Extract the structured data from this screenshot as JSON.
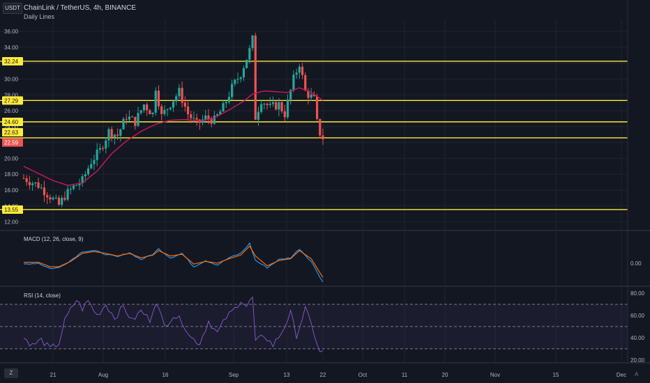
{
  "header": {
    "symbol_line": "ChainLink / TetherUS, 4h, BINANCE",
    "indicator_label": "Daily Lines"
  },
  "toolbar": {
    "unit_button": "USDT",
    "goto_button": "Z",
    "auto_button": "A"
  },
  "colors": {
    "background": "#131722",
    "grid": "#1f2430",
    "up_candle": "#26a69a",
    "down_candle": "#ef5350",
    "level_line": "#ffeb3b",
    "ma_line": "#c2185b",
    "macd_line": "#2196f3",
    "signal_line": "#ff6d00",
    "rsi_line": "#7e57c2",
    "rsi_band": "#7e57c2"
  },
  "chart_data": [
    {
      "type": "candlestick",
      "title": "ChainLink / TetherUS, 4h, BINANCE",
      "y_axis_ticks": [
        12,
        14,
        16,
        18,
        20,
        22,
        24,
        26,
        28,
        30,
        32,
        34,
        36
      ],
      "ylim": [
        11,
        37.5
      ],
      "x_axis_ticks": [
        "21",
        "Aug",
        "16",
        "Sep",
        "13",
        "22",
        "Oct",
        "11",
        "20",
        "Nov",
        "15",
        "Dec"
      ],
      "horizontal_levels": [
        32.24,
        27.29,
        24.6,
        13.55,
        22.59
      ],
      "price_tags": [
        {
          "value": 32.24,
          "label": "32.24",
          "style": "yellow"
        },
        {
          "value": 27.29,
          "label": "27.29",
          "style": "yellow"
        },
        {
          "value": 24.6,
          "label": "24.60",
          "style": "yellow"
        },
        {
          "value": 23.3,
          "label": "22.63",
          "style": "yellow"
        },
        {
          "value": 22.0,
          "label": "22.59",
          "style": "red"
        },
        {
          "value": 13.55,
          "label": "13.55",
          "style": "yellow"
        }
      ],
      "price_anchors": [
        [
          0,
          17.5
        ],
        [
          5,
          16.6
        ],
        [
          9,
          15.2
        ],
        [
          12,
          14.1
        ],
        [
          14,
          15.3
        ],
        [
          17,
          16.4
        ],
        [
          20,
          17.2
        ],
        [
          23,
          19.6
        ],
        [
          26,
          21.0
        ],
        [
          29,
          23.4
        ],
        [
          32,
          22.9
        ],
        [
          35,
          25.3
        ],
        [
          38,
          24.6
        ],
        [
          41,
          26.8
        ],
        [
          44,
          25.6
        ],
        [
          45,
          29.0
        ],
        [
          47,
          25.3
        ],
        [
          50,
          26.9
        ],
        [
          53,
          28.4
        ],
        [
          56,
          25.6
        ],
        [
          59,
          24.3
        ],
        [
          62,
          25.1
        ],
        [
          65,
          24.8
        ],
        [
          68,
          26.4
        ],
        [
          71,
          28.9
        ],
        [
          74,
          30.7
        ],
        [
          77,
          33.6
        ],
        [
          78,
          35.0
        ],
        [
          79,
          25.2
        ],
        [
          81,
          27.4
        ],
        [
          84,
          26.4
        ],
        [
          87,
          26.8
        ],
        [
          89,
          25.6
        ],
        [
          92,
          30.0
        ],
        [
          94,
          32.0
        ],
        [
          96,
          28.4
        ],
        [
          99,
          27.4
        ],
        [
          100,
          24.5
        ],
        [
          101,
          23.2
        ],
        [
          102,
          22.6
        ]
      ],
      "moving_average": {
        "name": "",
        "anchors": [
          [
            0,
            19.0
          ],
          [
            5,
            18.1
          ],
          [
            10,
            17.2
          ],
          [
            15,
            16.6
          ],
          [
            20,
            16.9
          ],
          [
            25,
            18.4
          ],
          [
            30,
            20.6
          ],
          [
            35,
            22.2
          ],
          [
            40,
            23.4
          ],
          [
            45,
            24.3
          ],
          [
            50,
            24.8
          ],
          [
            55,
            24.9
          ],
          [
            60,
            24.7
          ],
          [
            65,
            25.1
          ],
          [
            70,
            26.1
          ],
          [
            75,
            27.2
          ],
          [
            78,
            28.1
          ],
          [
            82,
            28.5
          ],
          [
            86,
            28.4
          ],
          [
            90,
            28.3
          ],
          [
            94,
            28.9
          ],
          [
            98,
            28.3
          ],
          [
            102,
            27.3
          ]
        ]
      },
      "candles_shown_until_fraction_of_time_axis": 0.48
    },
    {
      "type": "line",
      "title": "MACD (12, 26, close, 9)",
      "y_axis_ticks": [
        0.0
      ],
      "ylim": [
        -2.5,
        3.5
      ],
      "series": [
        {
          "name": "",
          "anchors": [
            [
              0,
              -0.1
            ],
            [
              5,
              0.0
            ],
            [
              9,
              -0.6
            ],
            [
              12,
              -0.5
            ],
            [
              16,
              0.3
            ],
            [
              20,
              1.3
            ],
            [
              24,
              1.4
            ],
            [
              28,
              1.0
            ],
            [
              32,
              0.7
            ],
            [
              36,
              1.2
            ],
            [
              40,
              0.4
            ],
            [
              44,
              1.0
            ],
            [
              46,
              1.6
            ],
            [
              50,
              0.6
            ],
            [
              54,
              1.1
            ],
            [
              58,
              -0.4
            ],
            [
              62,
              0.3
            ],
            [
              66,
              -0.2
            ],
            [
              70,
              0.6
            ],
            [
              74,
              1.1
            ],
            [
              77,
              2.2
            ],
            [
              79,
              0.3
            ],
            [
              83,
              -0.5
            ],
            [
              87,
              0.4
            ],
            [
              91,
              0.6
            ],
            [
              94,
              1.6
            ],
            [
              98,
              0.2
            ],
            [
              102,
              -2.1
            ]
          ]
        },
        {
          "name": "",
          "anchors": [
            [
              0,
              0.1
            ],
            [
              5,
              0.1
            ],
            [
              9,
              -0.4
            ],
            [
              12,
              -0.4
            ],
            [
              16,
              0.2
            ],
            [
              20,
              1.1
            ],
            [
              24,
              1.3
            ],
            [
              28,
              1.1
            ],
            [
              32,
              0.8
            ],
            [
              36,
              1.1
            ],
            [
              40,
              0.6
            ],
            [
              44,
              0.9
            ],
            [
              46,
              1.4
            ],
            [
              50,
              0.8
            ],
            [
              54,
              1.0
            ],
            [
              58,
              -0.1
            ],
            [
              62,
              0.2
            ],
            [
              66,
              0.0
            ],
            [
              70,
              0.5
            ],
            [
              74,
              0.9
            ],
            [
              77,
              1.9
            ],
            [
              79,
              0.8
            ],
            [
              83,
              -0.3
            ],
            [
              87,
              0.3
            ],
            [
              91,
              0.5
            ],
            [
              94,
              1.4
            ],
            [
              98,
              0.5
            ],
            [
              102,
              -1.6
            ]
          ]
        }
      ]
    },
    {
      "type": "line",
      "title": "RSI (14, close)",
      "y_axis_ticks": [
        20.0,
        40.0,
        60.0,
        80.0
      ],
      "ylim": [
        18,
        85
      ],
      "band": [
        30,
        70
      ],
      "midline": 50,
      "series": [
        {
          "name": "",
          "anchors": [
            [
              0,
              40
            ],
            [
              3,
              33
            ],
            [
              6,
              38
            ],
            [
              9,
              30
            ],
            [
              12,
              35
            ],
            [
              14,
              55
            ],
            [
              16,
              65
            ],
            [
              18,
              74
            ],
            [
              20,
              66
            ],
            [
              22,
              73
            ],
            [
              25,
              60
            ],
            [
              28,
              70
            ],
            [
              31,
              58
            ],
            [
              34,
              68
            ],
            [
              37,
              55
            ],
            [
              40,
              64
            ],
            [
              43,
              56
            ],
            [
              45,
              73
            ],
            [
              48,
              50
            ],
            [
              51,
              60
            ],
            [
              54,
              55
            ],
            [
              57,
              40
            ],
            [
              60,
              35
            ],
            [
              63,
              55
            ],
            [
              66,
              44
            ],
            [
              69,
              58
            ],
            [
              72,
              66
            ],
            [
              74,
              74
            ],
            [
              76,
              68
            ],
            [
              78,
              76
            ],
            [
              79,
              36
            ],
            [
              82,
              42
            ],
            [
              85,
              33
            ],
            [
              88,
              45
            ],
            [
              91,
              62
            ],
            [
              93,
              42
            ],
            [
              96,
              66
            ],
            [
              99,
              44
            ],
            [
              101,
              26
            ],
            [
              102,
              28
            ]
          ]
        }
      ]
    }
  ]
}
